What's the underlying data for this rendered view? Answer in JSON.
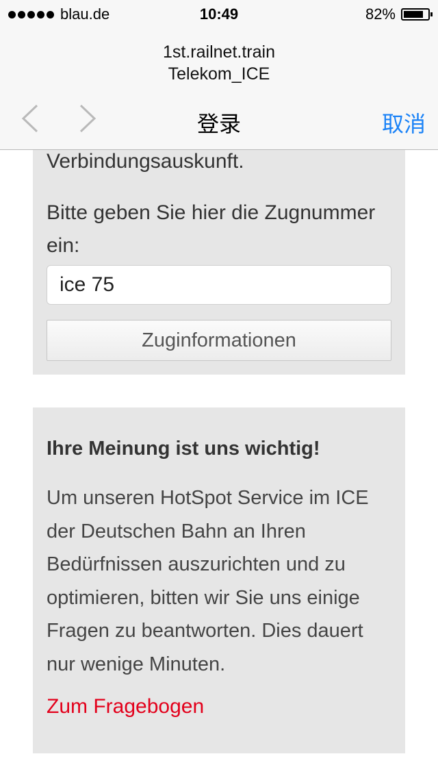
{
  "status_bar": {
    "carrier": "blau.de",
    "time": "10:49",
    "battery": "82%",
    "battery_level": 0.82,
    "signal_dots": 5
  },
  "url_area": {
    "line1": "1st.railnet.train",
    "line2": "Telekom_ICE"
  },
  "nav_bar": {
    "title": "登录",
    "cancel_label": "取消"
  },
  "panel_train": {
    "previous_line_end": "Verbindungsauskunft.",
    "prompt": "Bitte geben Sie hier die Zugnummer ein:",
    "train_number_value": "ice 75",
    "button_label": "Zuginformationen"
  },
  "panel_feedback": {
    "heading": "Ihre Meinung ist uns wichtig!",
    "body": "Um unseren HotSpot Service im ICE der Deutschen Bahn an Ihren Bedürfnissen auszurichten und zu optimieren, bitten wir Sie uns einige Fragen zu beantworten. Dies dauert nur wenige Minuten.",
    "link": "Zum Fragebogen"
  },
  "colors": {
    "accent_blue": "#1a82f7",
    "link_red": "#e3001b",
    "panel_gray": "#e6e6e6"
  }
}
